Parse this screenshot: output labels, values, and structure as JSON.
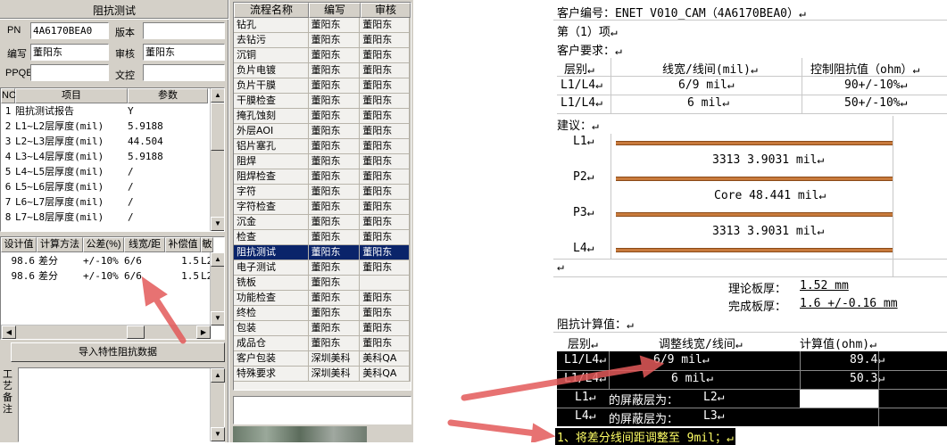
{
  "left_panel": {
    "title": "阻抗测试",
    "pn_label": "PN",
    "pn_value": "4A6170BEA0",
    "version_label": "版本",
    "version_value": "",
    "editor_label": "编写",
    "editor_value": "董阳东",
    "reviewer_label": "审核",
    "reviewer_value": "董阳东",
    "ppqe_label": "PPQE",
    "ppqe_value": "",
    "doc_control_label": "文控",
    "doc_control_value": "",
    "param_table": {
      "headers": [
        "NO",
        "项目",
        "参数"
      ],
      "rows": [
        [
          "1",
          "阻抗测试报告",
          "Y"
        ],
        [
          "2",
          "L1~L2层厚度(mil)",
          "5.9188"
        ],
        [
          "3",
          "L2~L3层厚度(mil)",
          "44.504"
        ],
        [
          "4",
          "L3~L4层厚度(mil)",
          "5.9188"
        ],
        [
          "5",
          "L4~L5层厚度(mil)",
          "/"
        ],
        [
          "6",
          "L5~L6层厚度(mil)",
          "/"
        ],
        [
          "7",
          "L6~L7层厚度(mil)",
          "/"
        ],
        [
          "8",
          "L7~L8层厚度(mil)",
          "/"
        ]
      ]
    },
    "calc_table": {
      "headers": [
        "设计值",
        "计算方法",
        "公差(%)",
        "线宽/距",
        "补偿值",
        "敏"
      ],
      "rows": [
        [
          "98.6",
          "差分",
          "+/-10%",
          "6/6",
          "1.5",
          "L2"
        ],
        [
          "98.6",
          "差分",
          "+/-10%",
          "6/6",
          "1.5",
          "L2"
        ]
      ]
    },
    "import_button": "导入特性阻抗数据",
    "notes_label": "工艺备注"
  },
  "process_table": {
    "headers": [
      "流程名称",
      "编写",
      "审核"
    ],
    "rows": [
      [
        "钻孔",
        "董阳东",
        "董阳东"
      ],
      [
        "去钻污",
        "董阳东",
        "董阳东"
      ],
      [
        "沉铜",
        "董阳东",
        "董阳东"
      ],
      [
        "负片电镀",
        "董阳东",
        "董阳东"
      ],
      [
        "负片干膜",
        "董阳东",
        "董阳东"
      ],
      [
        "干膜检查",
        "董阳东",
        "董阳东"
      ],
      [
        "掩孔蚀刻",
        "董阳东",
        "董阳东"
      ],
      [
        "外层AOI",
        "董阳东",
        "董阳东"
      ],
      [
        "铝片塞孔",
        "董阳东",
        "董阳东"
      ],
      [
        "阻焊",
        "董阳东",
        "董阳东"
      ],
      [
        "阻焊检查",
        "董阳东",
        "董阳东"
      ],
      [
        "字符",
        "董阳东",
        "董阳东"
      ],
      [
        "字符检查",
        "董阳东",
        "董阳东"
      ],
      [
        "沉金",
        "董阳东",
        "董阳东"
      ],
      [
        "检查",
        "董阳东",
        "董阳东"
      ],
      [
        "阻抗测试",
        "董阳东",
        "董阳东"
      ],
      [
        "电子测试",
        "董阳东",
        "董阳东"
      ],
      [
        "铣板",
        "董阳东",
        ""
      ],
      [
        "功能检查",
        "董阳东",
        "董阳东"
      ],
      [
        "终检",
        "董阳东",
        "董阳东"
      ],
      [
        "包装",
        "董阳东",
        "董阳东"
      ],
      [
        "成品仓",
        "董阳东",
        "董阳东"
      ],
      [
        "客户包装",
        "深圳美科",
        "美科QA"
      ],
      [
        "特殊要求",
        "深圳美科",
        "美科QA"
      ]
    ],
    "selected_index": 15
  },
  "document": {
    "customer_no": "客户编号：ENET V010_CAM（4A6170BEA0）↵",
    "item_no": "第（1）项↵",
    "requirement": "客户要求：↵",
    "req_headers": [
      "层别↵",
      "线宽/线间(mil)↵",
      "控制阻抗值（ohm）↵"
    ],
    "req_rows": [
      [
        "L1/L4↵",
        "6/9 mil↵",
        "90+/-10%↵"
      ],
      [
        "L1/L4↵",
        "6 mil↵",
        "50+/-10%↵"
      ]
    ],
    "suggestion": "建议：↵",
    "stack": {
      "L1": "L1↵",
      "d1": "3313      3.9031 mil↵",
      "P2": "P2↵",
      "core": "Core    48.441 mil↵",
      "P3": "P3↵",
      "d2": "3313      3.9031 mil↵",
      "L4": "L4↵"
    },
    "theory_thickness_label": "理论板厚：",
    "theory_thickness_value": "1.52 mm",
    "finished_thickness_label": "完成板厚：",
    "finished_thickness_value": "1.6 +/-0.16 mm",
    "calc_label": "阻抗计算值：↵",
    "calc_headers": [
      "层别↵",
      "调整线宽/线间↵",
      "计算值(ohm)↵"
    ],
    "calc_rows": [
      [
        "L1/L4↵",
        "6/9 mil↵",
        "89.4↵"
      ],
      [
        "L1/L4↵",
        "6 mil↵",
        "50.3↵"
      ]
    ],
    "shield_rows": [
      [
        "L1↵",
        "的屏蔽层为：",
        "L2↵"
      ],
      [
        "L4↵",
        "的屏蔽层为：",
        "L3↵"
      ]
    ],
    "note": "1、将差分线间距调整至 9mil；↵",
    "para_mark": "↵"
  },
  "colors": {
    "arrow": "#e35a5a",
    "selection": "#0a246a",
    "copper": "#c87a3c",
    "note_yellow": "#ffff66"
  }
}
